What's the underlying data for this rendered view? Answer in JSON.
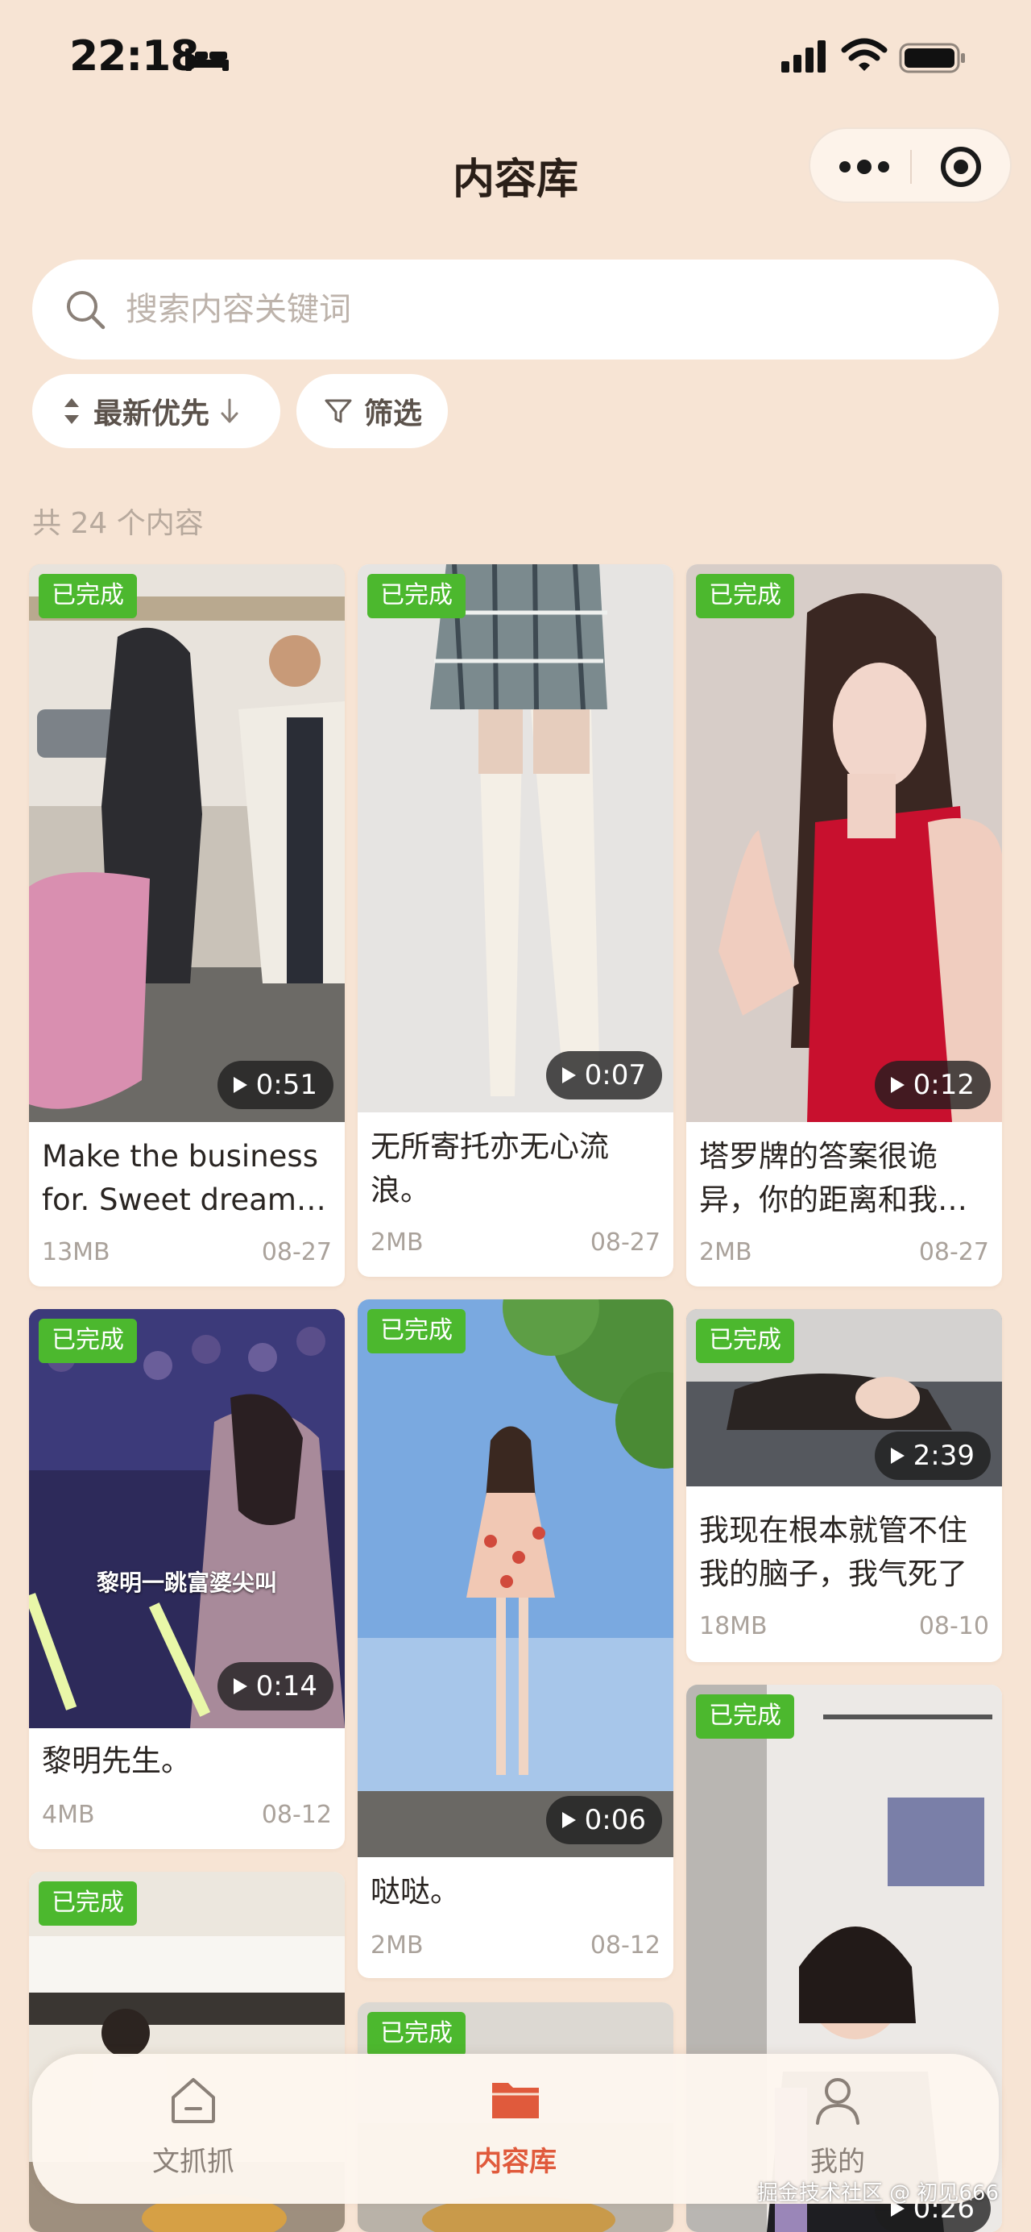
{
  "status_bar": {
    "time": "22:18"
  },
  "header": {
    "title": "内容库"
  },
  "search": {
    "placeholder": "搜索内容关键词"
  },
  "filters": {
    "sort_label": "最新优先",
    "filter_label": "筛选"
  },
  "summary": {
    "count_text": "共 24 个内容"
  },
  "badge_color": "#4cb82e",
  "accent_color": "#e05a3c",
  "cards": [
    {
      "badge": "已完成",
      "duration": "0:51",
      "title": "Make the business for. Sweet dreams are made of this",
      "size": "13MB",
      "date": "08-27"
    },
    {
      "badge": "已完成",
      "duration": "0:07",
      "title": "无所寄托亦无心流浪。",
      "size": "2MB",
      "date": "08-27"
    },
    {
      "badge": "已完成",
      "duration": "0:12",
      "title": "塔罗牌的答案很诡异，你的距离和我的距离",
      "size": "2MB",
      "date": "08-27"
    },
    {
      "badge": "已完成",
      "duration": "0:14",
      "overlay_text": "黎明一跳富婆尖叫",
      "title": "黎明先生。",
      "size": "4MB",
      "date": "08-12"
    },
    {
      "badge": "已完成",
      "duration": "0:06",
      "title": "哒哒。",
      "size": "2MB",
      "date": "08-12"
    },
    {
      "badge": "已完成",
      "duration": "2:39",
      "title": "我现在根本就管不住我的脑子，我气死了",
      "size": "18MB",
      "date": "08-10"
    },
    {
      "badge": "已完成"
    },
    {
      "badge": "已完成"
    },
    {
      "badge": "已完成",
      "duration": "0:26"
    }
  ],
  "tabbar": {
    "items": [
      {
        "label": "文抓抓",
        "icon": "home-icon"
      },
      {
        "label": "内容库",
        "icon": "folder-icon"
      },
      {
        "label": "我的",
        "icon": "user-icon"
      }
    ]
  },
  "watermark": "掘金技术社区 @ 初见666"
}
